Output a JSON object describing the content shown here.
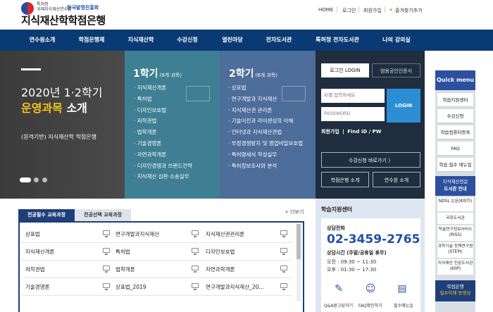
{
  "header": {
    "agency_line1": "특허청",
    "agency_line2": "국제지식재산연수원",
    "partner": "한국발명진흥회",
    "site_title": "지식재산학학점은행",
    "util_links": [
      "HOME",
      "로그인",
      "회원가입",
      "즐겨찾기추가"
    ]
  },
  "nav": {
    "items": [
      "연수원소개",
      "학점은행제",
      "지식재산학",
      "수강신청",
      "열린마당",
      "전자도서관",
      "특허청 전자도서관",
      "나의 강의실"
    ]
  },
  "banner": {
    "title_line1": "2020년 1·2학기",
    "title_line2_highlight": "운영과목",
    "title_line2_rest": " 소개",
    "subtitle": "(원격기반) 지식재산학 학점은행",
    "semester1": {
      "num": "1",
      "label": "학기",
      "count": "(9개 과목)",
      "courses": [
        "지식재산개론",
        "특허법",
        "디자인보호법",
        "저작권법",
        "법학개론",
        "기술경영론",
        "자연과학개론",
        "디자인경영과 브랜드전략",
        "지식재산 심판·소송실무"
      ]
    },
    "semester2": {
      "num": "2",
      "label": "학기",
      "count": "(8개 과목)",
      "courses": [
        "상표법",
        "연구개발과 지식재산",
        "지식재산권 관리론",
        "기술이전과 라이센싱의 이해",
        "인터넷과 지식재산권법",
        "부정경쟁방지 및 영업비밀보호법",
        "특허명세서 작성실무",
        "특허정보조사와 분석"
      ]
    }
  },
  "login": {
    "tab_login": "로그인 LOGIN",
    "tab_cert": "범용공인인증서",
    "id_placeholder": "ID를 입력하세요",
    "pw_placeholder": "PASSWORD",
    "login_button": "LOGIN",
    "signup": "회원가입",
    "find": "Find ID / PW",
    "apply_button": "수강신청 바로가기 〉",
    "credit_bank_button": "학점은행 소개",
    "training_button": "연수원 소개"
  },
  "quick_menu": {
    "title": "Quick menu",
    "items": [
      "학습지원센터",
      "수강신청",
      "학습컴퓨터등록",
      "FAQ",
      "학습 필수 매뉴얼"
    ],
    "section_title_1": "지식재산전문",
    "section_title_2": "도서관 안내",
    "links": [
      "NDSL 논문(KISTI)",
      "국회도서관",
      "학술연구정보서비스(RISS)",
      "과학기술 정책연구원(STEPI)",
      "지식재산 전문도서관(KIIP)"
    ],
    "banner_1": "학점은행",
    "banner_2": "필수이해 동영상"
  },
  "courses": {
    "tab_required": "전공필수 교육과정",
    "tab_elective": "전공선택 교육과정",
    "more": "+ 더보기",
    "rows": [
      [
        "상표법",
        "연구개발과지식재산",
        "지식재산권관리론"
      ],
      [
        "지식재산개론",
        "특허법",
        "디자인보호법"
      ],
      [
        "저작권법",
        "법학개론",
        "자연과학개론"
      ],
      [
        "기술경영론",
        "상표법_2019",
        "연구개발과지식재산_20..."
      ]
    ]
  },
  "support": {
    "title": "학습지원센터",
    "phone_label": "상담전화",
    "phone": "02-3459-2765",
    "hours_label": "상담시간 (주말/공휴일 휴무)",
    "am": "오전 : 09:30 ~ 11:30",
    "pm": "오후 : 01:30 ~ 17:30",
    "links": [
      "Q&A묻고답하기",
      "FAQ확인하기",
      "필수매뉴얼"
    ]
  },
  "colors": {
    "nav": "#0a3a73",
    "semester1": "#3e7f93",
    "semester2": "#4d6d9a",
    "login_bg": "#1f2d3f",
    "login_button": "#2b8ed3",
    "accent_yellow": "#f5c518"
  }
}
